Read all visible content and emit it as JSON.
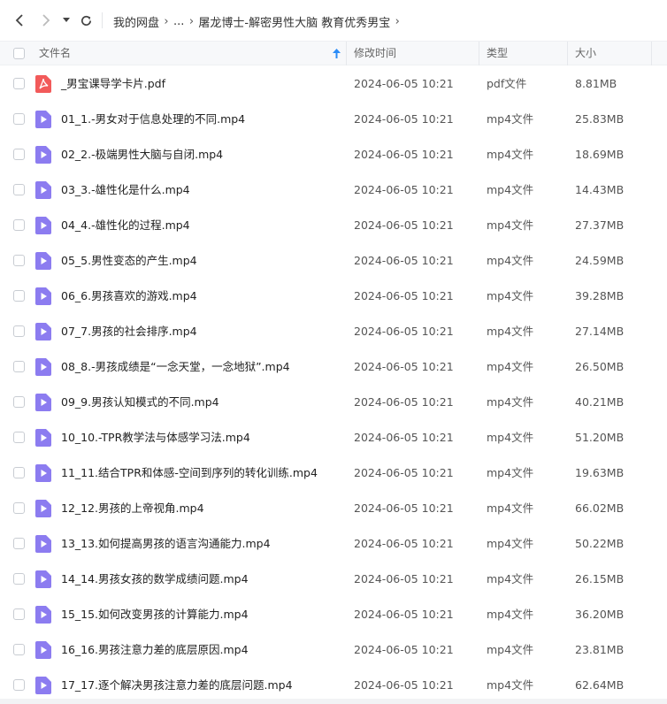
{
  "nav": {
    "breadcrumb": [
      "我的网盘",
      "...",
      "屠龙博士-解密男性大脑 教育优秀男宝"
    ]
  },
  "header": {
    "name": "文件名",
    "modified": "修改时间",
    "type": "类型",
    "size": "大小"
  },
  "files": [
    {
      "name": "_男宝课导学卡片.pdf",
      "modified": "2024-06-05 10:21",
      "type": "pdf文件",
      "size": "8.81MB",
      "icon": "pdf-icon"
    },
    {
      "name": "01_1.-男女对于信息处理的不同.mp4",
      "modified": "2024-06-05 10:21",
      "type": "mp4文件",
      "size": "25.83MB",
      "icon": "video-icon"
    },
    {
      "name": "02_2.-极端男性大脑与自闭.mp4",
      "modified": "2024-06-05 10:21",
      "type": "mp4文件",
      "size": "18.69MB",
      "icon": "video-icon"
    },
    {
      "name": "03_3.-雄性化是什么.mp4",
      "modified": "2024-06-05 10:21",
      "type": "mp4文件",
      "size": "14.43MB",
      "icon": "video-icon"
    },
    {
      "name": "04_4.-雄性化的过程.mp4",
      "modified": "2024-06-05 10:21",
      "type": "mp4文件",
      "size": "27.37MB",
      "icon": "video-icon"
    },
    {
      "name": "05_5.男性变态的产生.mp4",
      "modified": "2024-06-05 10:21",
      "type": "mp4文件",
      "size": "24.59MB",
      "icon": "video-icon"
    },
    {
      "name": "06_6.男孩喜欢的游戏.mp4",
      "modified": "2024-06-05 10:21",
      "type": "mp4文件",
      "size": "39.28MB",
      "icon": "video-icon"
    },
    {
      "name": "07_7.男孩的社会排序.mp4",
      "modified": "2024-06-05 10:21",
      "type": "mp4文件",
      "size": "27.14MB",
      "icon": "video-icon"
    },
    {
      "name": "08_8.-男孩成绩是“一念天堂，一念地狱”.mp4",
      "modified": "2024-06-05 10:21",
      "type": "mp4文件",
      "size": "26.50MB",
      "icon": "video-icon"
    },
    {
      "name": "09_9.男孩认知模式的不同.mp4",
      "modified": "2024-06-05 10:21",
      "type": "mp4文件",
      "size": "40.21MB",
      "icon": "video-icon"
    },
    {
      "name": "10_10.-TPR教学法与体感学习法.mp4",
      "modified": "2024-06-05 10:21",
      "type": "mp4文件",
      "size": "51.20MB",
      "icon": "video-icon"
    },
    {
      "name": "11_11.结合TPR和体感-空间到序列的转化训练.mp4",
      "modified": "2024-06-05 10:21",
      "type": "mp4文件",
      "size": "19.63MB",
      "icon": "video-icon"
    },
    {
      "name": "12_12.男孩的上帝视角.mp4",
      "modified": "2024-06-05 10:21",
      "type": "mp4文件",
      "size": "66.02MB",
      "icon": "video-icon"
    },
    {
      "name": "13_13.如何提高男孩的语言沟通能力.mp4",
      "modified": "2024-06-05 10:21",
      "type": "mp4文件",
      "size": "50.22MB",
      "icon": "video-icon"
    },
    {
      "name": "14_14.男孩女孩的数学成绩问题.mp4",
      "modified": "2024-06-05 10:21",
      "type": "mp4文件",
      "size": "26.15MB",
      "icon": "video-icon"
    },
    {
      "name": "15_15.如何改变男孩的计算能力.mp4",
      "modified": "2024-06-05 10:21",
      "type": "mp4文件",
      "size": "36.20MB",
      "icon": "video-icon"
    },
    {
      "name": "16_16.男孩注意力差的底层原因.mp4",
      "modified": "2024-06-05 10:21",
      "type": "mp4文件",
      "size": "23.81MB",
      "icon": "video-icon"
    },
    {
      "name": "17_17.逐个解决男孩注意力差的底层问题.mp4",
      "modified": "2024-06-05 10:21",
      "type": "mp4文件",
      "size": "62.64MB",
      "icon": "video-icon"
    }
  ],
  "colors": {
    "pdf": "#f25a5a",
    "video": "#8c7cf0",
    "sort_arrow": "#2b8cf7"
  }
}
